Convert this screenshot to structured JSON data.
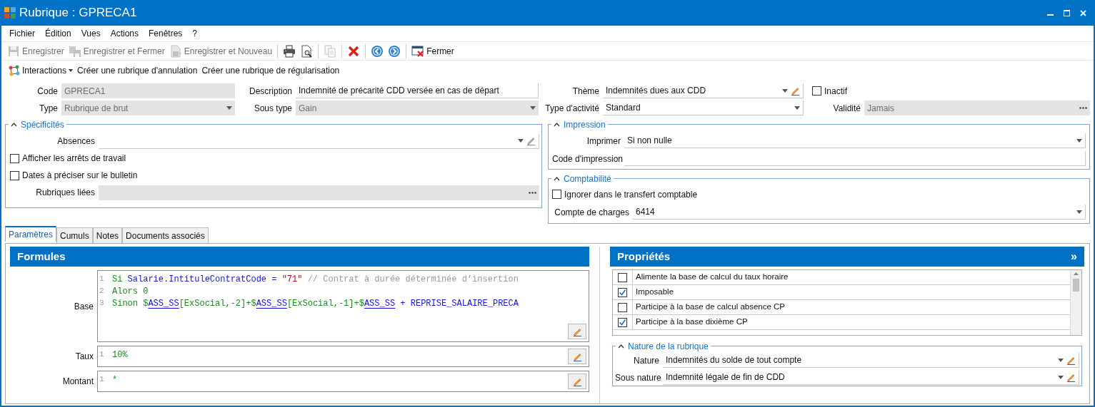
{
  "window": {
    "title": "Rubrique : GPRECA1"
  },
  "menu": [
    "Fichier",
    "Édition",
    "Vues",
    "Actions",
    "Fenêtres",
    "?"
  ],
  "toolbar": [
    {
      "kind": "save",
      "label": "Enregistrer",
      "disabled": true
    },
    {
      "kind": "save-close",
      "label": "Enregistrer et Fermer",
      "disabled": true
    },
    {
      "kind": "save-new",
      "label": "Enregistrer et Nouveau",
      "disabled": true
    },
    {
      "kind": "separator"
    },
    {
      "kind": "print",
      "disabled": false
    },
    {
      "kind": "preview",
      "disabled": false
    },
    {
      "kind": "separator"
    },
    {
      "kind": "copy",
      "disabled": true
    },
    {
      "kind": "separator"
    },
    {
      "kind": "delete",
      "disabled": false
    },
    {
      "kind": "separator"
    },
    {
      "kind": "back",
      "disabled": false
    },
    {
      "kind": "forward",
      "disabled": false
    },
    {
      "kind": "separator"
    },
    {
      "kind": "close",
      "label": "Fermer",
      "disabled": false
    }
  ],
  "actions": {
    "interactions": "Interactions",
    "links": [
      "Créer une rubrique d'annulation",
      "Créer une rubrique de régularisation"
    ]
  },
  "header_rows": [
    [
      {
        "kind": "text",
        "label": "Code",
        "value": "GPRECA1",
        "disabled": true
      },
      {
        "kind": "text",
        "label": "Description",
        "value": "Indemnité de précarité CDD versée en cas de départ",
        "disabled": false
      },
      {
        "kind": "select",
        "label": "Thème",
        "value": "Indemnités dues aux CDD",
        "disabled": false,
        "editable": true
      },
      {
        "kind": "checkbox",
        "label": "Inactif",
        "checked": false
      }
    ],
    [
      {
        "kind": "select",
        "label": "Type",
        "value": "Rubrique de brut",
        "disabled": true
      },
      {
        "kind": "select",
        "label": "Sous type",
        "value": "Gain",
        "disabled": true
      },
      {
        "kind": "select",
        "label": "Type d'activité",
        "value": "Standard",
        "disabled": false
      },
      {
        "kind": "lookup",
        "label": "Validité",
        "value": "Jamais",
        "disabled": true
      }
    ]
  ],
  "specificites": {
    "title": "Spécificités",
    "expanded": true,
    "items": [
      {
        "kind": "select",
        "label": "Absences",
        "value": "",
        "disabled": false,
        "editable": true
      },
      {
        "kind": "checkbox",
        "label": "Afficher les arrêts de travail",
        "checked": false
      },
      {
        "kind": "checkbox",
        "label": "Dates à préciser sur le bulletin",
        "checked": false
      },
      {
        "kind": "lookup",
        "label": "Rubriques liées",
        "disabled": true
      }
    ]
  },
  "impression": {
    "title": "Impression",
    "expanded": true,
    "items": [
      {
        "kind": "select",
        "label": "Imprimer",
        "value": "Si non nulle",
        "disabled": false
      },
      {
        "kind": "text",
        "label": "Code d'impression",
        "disabled": false
      }
    ]
  },
  "comptabilite": {
    "title": "Comptabilité",
    "expanded": true,
    "items": [
      {
        "kind": "checkbox",
        "label": "Ignorer dans le transfert comptable",
        "checked": false
      },
      {
        "kind": "select",
        "label": "Compte de charges",
        "value": "6414",
        "disabled": false
      }
    ]
  },
  "tabs": [
    {
      "label": "Paramètres",
      "selected": true
    },
    {
      "label": "Cumuls",
      "selected": false
    },
    {
      "label": "Notes",
      "selected": false
    },
    {
      "label": "Documents associés",
      "selected": false
    }
  ],
  "formules": {
    "title": "Formules",
    "rows": [
      {
        "label": "Base",
        "lines": [
          {
            "number": "1",
            "tokens": [
              {
                "kind": "keyword",
                "text": "Si "
              },
              {
                "kind": "ident",
                "text": "Salarie.IntituleContratCode = "
              },
              {
                "kind": "string",
                "text": "\"71\""
              },
              {
                "kind": "comment",
                "text": " // Contrat à durée déterminée d’insertion"
              }
            ]
          },
          {
            "number": "2",
            "tokens": [
              {
                "kind": "keyword",
                "text": "Alors "
              },
              {
                "kind": "number",
                "text": "0"
              }
            ]
          },
          {
            "number": "3",
            "tokens": [
              {
                "kind": "keyword",
                "text": "Sinon $"
              },
              {
                "kind": "var",
                "text": "ASS_SS"
              },
              {
                "kind": "keyword",
                "text": "[ExSocial,-2]+$"
              },
              {
                "kind": "var",
                "text": "ASS_SS"
              },
              {
                "kind": "keyword",
                "text": "[ExSocial,-1]+$"
              },
              {
                "kind": "var",
                "text": "ASS_SS"
              },
              {
                "kind": "ident",
                "text": " + REPRISE_SALAIRE_PRECA"
              }
            ]
          }
        ]
      },
      {
        "label": "Taux",
        "lines": [
          {
            "number": "1",
            "tokens": [
              {
                "kind": "number",
                "text": "10%"
              }
            ]
          }
        ]
      },
      {
        "label": "Montant",
        "lines": [
          {
            "number": "1",
            "tokens": [
              {
                "kind": "keyword",
                "text": "*"
              }
            ]
          }
        ]
      }
    ]
  },
  "proprietes": {
    "title": "Propriétés",
    "expand": "»",
    "items": [
      {
        "label": "Alimente la base de calcul du taux horaire",
        "checked": false
      },
      {
        "label": "Imposable",
        "checked": true
      },
      {
        "label": "Participe à la base de calcul absence CP",
        "checked": false
      },
      {
        "label": "Participe à la base dixième CP",
        "checked": true
      }
    ],
    "nature": {
      "title": "Nature de la rubrique",
      "expanded": true,
      "items": [
        {
          "label": "Nature",
          "value": "Indemnités du solde de tout compte"
        },
        {
          "label": "Sous nature",
          "value": "Indemnité légale de fin de CDD"
        }
      ]
    }
  }
}
